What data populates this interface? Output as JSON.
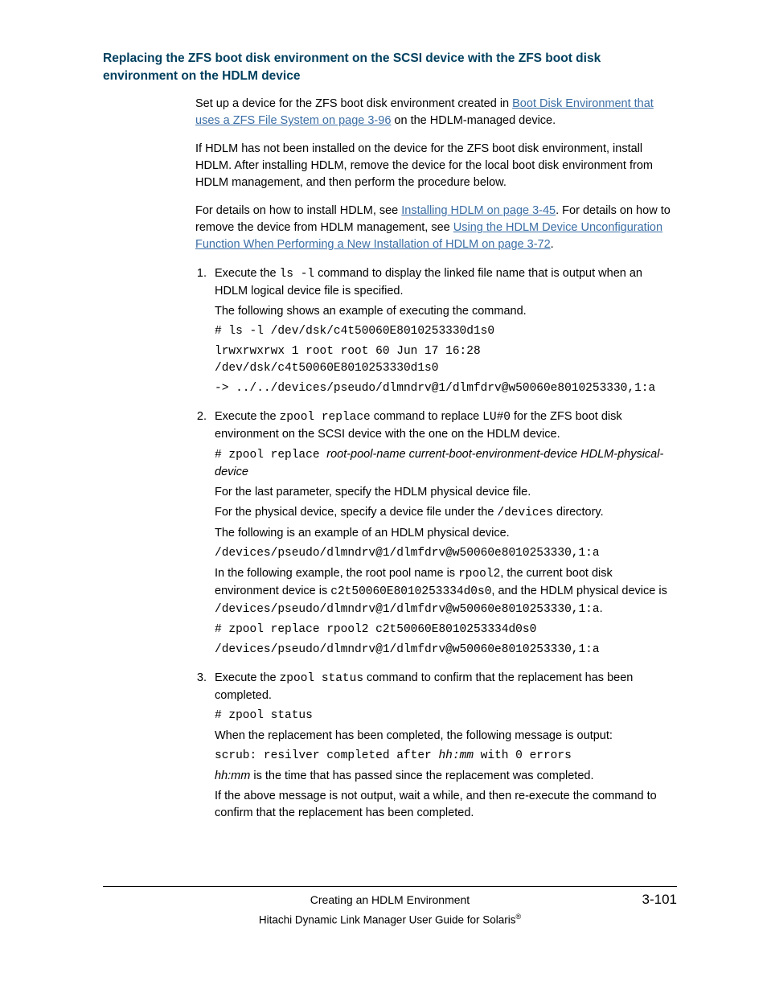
{
  "heading": "Replacing the ZFS boot disk environment on the SCSI device with the ZFS boot disk environment on the HDLM device",
  "intro": {
    "p1_pre": "Set up a device for the ZFS boot disk environment created in ",
    "p1_link": "Boot Disk Environment that uses a ZFS File System on page 3-96",
    "p1_post": " on the HDLM-managed device.",
    "p2": "If HDLM has not been installed on the device for the ZFS boot disk environment, install HDLM. After installing HDLM, remove the device for the local boot disk environment from HDLM management, and then perform the procedure below.",
    "p3_pre": "For details on how to install HDLM, see ",
    "p3_link1": "Installing HDLM on page 3-45",
    "p3_mid": ". For details on how to remove the device from HDLM management, see ",
    "p3_link2": "Using the HDLM Device Unconfiguration Function When Performing a New Installation of HDLM on page 3-72",
    "p3_post": "."
  },
  "step1": {
    "lead_pre": "Execute the ",
    "cmd": "ls -l",
    "lead_post": " command to display the linked file name that is output when an HDLM logical device file is specified.",
    "p1": "The following shows an example of executing the command.",
    "code1": "# ls -l /dev/dsk/c4t50060E8010253330d1s0",
    "code2": "lrwxrwxrwx 1 root root 60 Jun 17 16:28 /dev/dsk/c4t50060E8010253330d1s0",
    "code3": "-> ../../devices/pseudo/dlmndrv@1/dlmfdrv@w50060e8010253330,1:a"
  },
  "step2": {
    "lead_pre": "Execute the ",
    "cmd1": "zpool replace",
    "lead_mid": " command to replace ",
    "cmd2": "LU#0",
    "lead_post": " for the ZFS boot disk environment on the SCSI device with the one on the HDLM device.",
    "code_pre": "# zpool replace ",
    "code_args": "root-pool-name current-boot-environment-device HDLM-physical-device",
    "p1": "For the last parameter, specify the HDLM physical device file.",
    "p2_pre": "For the physical device, specify a device file under the ",
    "p2_mono": "/devices",
    "p2_post": " directory.",
    "p3": "The following is an example of an HDLM physical device.",
    "code_ex1": "/devices/pseudo/dlmndrv@1/dlmfdrv@w50060e8010253330,1:a",
    "p4_a": "In the following example, the root pool name is ",
    "p4_b": "rpool2",
    "p4_c": ", the current boot disk environment device is ",
    "p4_d": "c2t50060E8010253334d0s0",
    "p4_e": ", and the HDLM physical device is ",
    "p4_f": "/devices/pseudo/dlmndrv@1/dlmfdrv@w50060e8010253330,1:a",
    "p4_g": ".",
    "code_ex2": "# zpool replace rpool2 c2t50060E8010253334d0s0",
    "code_ex3": "/devices/pseudo/dlmndrv@1/dlmfdrv@w50060e8010253330,1:a"
  },
  "step3": {
    "lead_pre": "Execute the ",
    "cmd": "zpool status",
    "lead_post": " command to confirm that the replacement has been completed.",
    "code1": "# zpool status",
    "p1": "When the replacement has been completed, the following message is output:",
    "msg_pre": "scrub: resilver completed after ",
    "msg_var": "hh:mm",
    "msg_post": " with 0 errors",
    "p2_var": "hh:mm",
    "p2_post": " is the time that has passed since the replacement was completed.",
    "p3": "If the above message is not output, wait a while, and then re-execute the command to confirm that the replacement has been completed."
  },
  "footer": {
    "section": "Creating an HDLM Environment",
    "page": "3-101",
    "guide_pre": "Hitachi Dynamic Link Manager User Guide for Solaris",
    "reg": "®"
  }
}
